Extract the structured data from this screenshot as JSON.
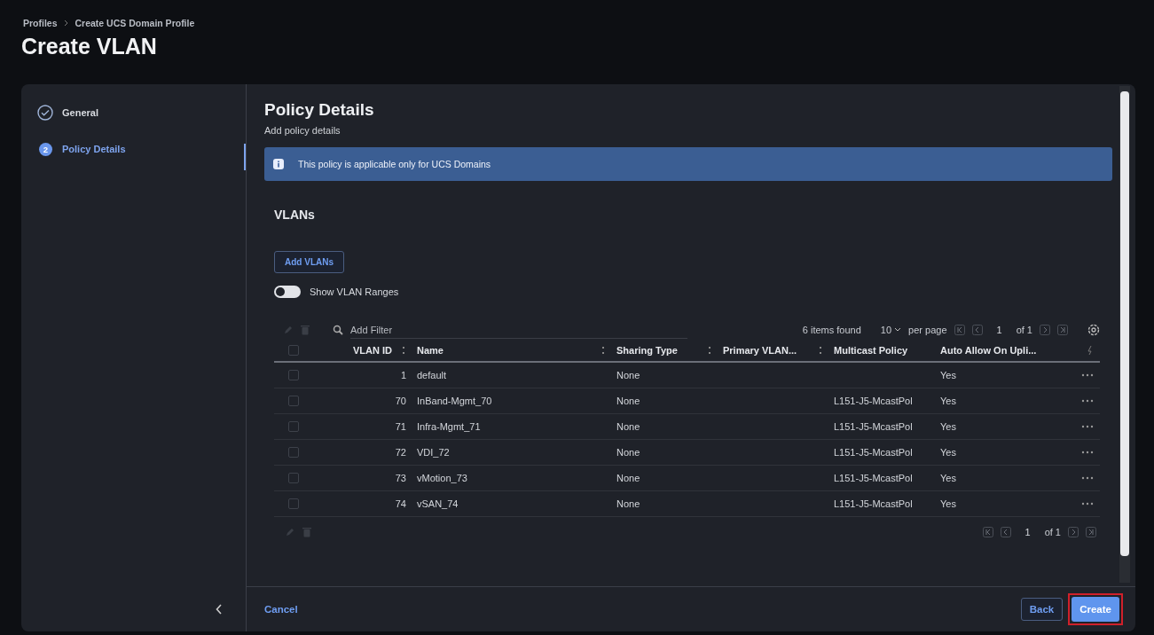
{
  "breadcrumb": [
    {
      "label": "Profiles"
    },
    {
      "label": "Create UCS Domain Profile"
    }
  ],
  "title": "Create VLAN",
  "steps": [
    {
      "label": "General",
      "kind": "done",
      "selected": false
    },
    {
      "label": "Policy Details",
      "number": "2",
      "kind": "current",
      "selected": true
    }
  ],
  "section": {
    "title": "Policy Details",
    "subtitle": "Add policy details"
  },
  "banner": "This policy is applicable only for UCS Domains",
  "vlans": {
    "title": "VLANs",
    "add_button": "Add VLANs",
    "toggle": {
      "label": "Show VLAN Ranges",
      "on": false
    },
    "filter_placeholder": "Add Filter",
    "items_found": "6 items found",
    "per_page_value": "10",
    "per_page_label": "per page",
    "page": "1",
    "of_pages": "of 1",
    "select_all_checked": false,
    "columns": [
      {
        "label": "VLAN ID",
        "sortable": true
      },
      {
        "label": "Name",
        "sortable": true
      },
      {
        "label": "Sharing Type",
        "sortable": true
      },
      {
        "label": "Primary VLAN...",
        "sortable": true
      },
      {
        "label": "Multicast Policy",
        "sortable": false
      },
      {
        "label": "Auto Allow On Upli...",
        "sortable": false
      }
    ],
    "rows": [
      {
        "checked": false,
        "cells": [
          "1",
          "default",
          "None",
          "",
          "",
          "Yes"
        ]
      },
      {
        "checked": false,
        "cells": [
          "70",
          "InBand-Mgmt_70",
          "None",
          "",
          "L151-J5-McastPol",
          "Yes"
        ]
      },
      {
        "checked": false,
        "cells": [
          "71",
          "Infra-Mgmt_71",
          "None",
          "",
          "L151-J5-McastPol",
          "Yes"
        ]
      },
      {
        "checked": false,
        "cells": [
          "72",
          "VDI_72",
          "None",
          "",
          "L151-J5-McastPol",
          "Yes"
        ]
      },
      {
        "checked": false,
        "cells": [
          "73",
          "vMotion_73",
          "None",
          "",
          "L151-J5-McastPol",
          "Yes"
        ]
      },
      {
        "checked": false,
        "cells": [
          "74",
          "vSAN_74",
          "None",
          "",
          "L151-J5-McastPol",
          "Yes"
        ]
      }
    ],
    "bottom_page": "1",
    "bottom_of_pages": "of 1"
  },
  "footer": {
    "cancel": "Cancel",
    "back": "Back",
    "create": {
      "label": "Create",
      "highlighted": true
    }
  }
}
